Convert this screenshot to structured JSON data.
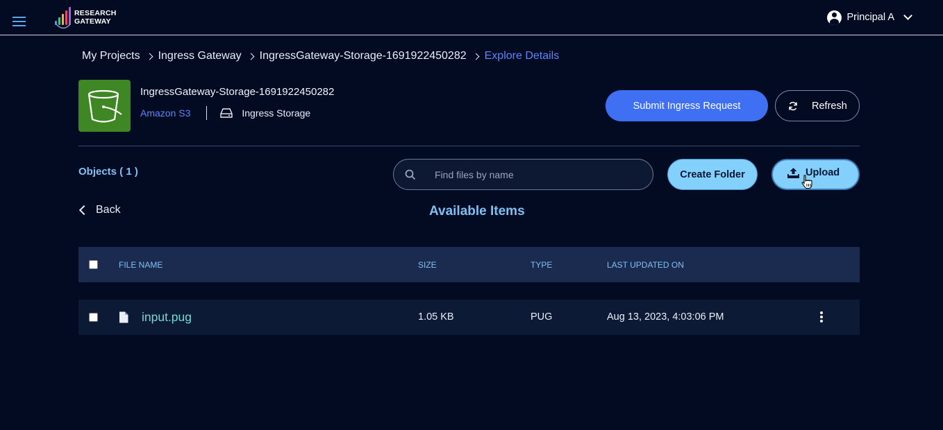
{
  "app": {
    "logo_line1": "RESEARCH",
    "logo_line2": "GATEWAY",
    "user_name": "Principal A"
  },
  "breadcrumb": [
    "My Projects",
    "Ingress Gateway",
    "IngressGateway-Storage-1691922450282",
    "Explore Details"
  ],
  "resource": {
    "title": "IngressGateway-Storage-1691922450282",
    "type": "Amazon S3",
    "subtype": "Ingress Storage"
  },
  "actions": {
    "submit_label": "Submit Ingress Request",
    "refresh_label": "Refresh",
    "create_folder_label": "Create Folder",
    "upload_label": "Upload"
  },
  "objects_label": "Objects ( 1 )",
  "search": {
    "placeholder": "Find files by name",
    "value": ""
  },
  "back_label": "Back",
  "section_title": "Available Items",
  "table": {
    "columns": [
      "FILE NAME",
      "SIZE",
      "TYPE",
      "LAST UPDATED ON"
    ],
    "rows": [
      {
        "name": "input.pug",
        "size": "1.05 KB",
        "type": "PUG",
        "updated": "Aug 13, 2023, 4:03:06 PM"
      }
    ]
  },
  "colors": {
    "background": "#020b22",
    "accent_blue": "#3f6ff2",
    "light_blue": "#82d0fb",
    "link_blue": "#5b86ff",
    "teal": "#75d9cf",
    "s3_green": "#3f8624"
  },
  "icons": [
    "hamburger-icon",
    "logo-icon",
    "user-icon",
    "chevron-down-icon",
    "bucket-icon",
    "drive-icon",
    "refresh-icon",
    "search-icon",
    "upload-icon",
    "back-chevron-icon",
    "file-icon",
    "kebab-menu-icon",
    "pointer-cursor-icon"
  ]
}
